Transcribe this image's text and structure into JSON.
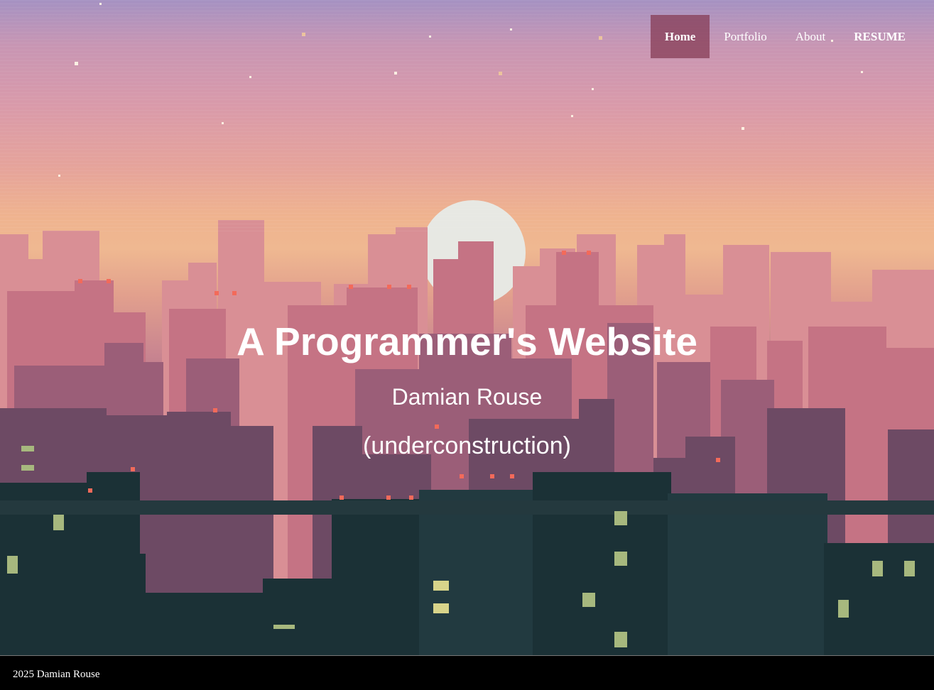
{
  "nav": {
    "items": [
      {
        "label": "Home"
      },
      {
        "label": "Portfolio"
      },
      {
        "label": "About"
      },
      {
        "label": "RESUME"
      }
    ]
  },
  "hero": {
    "title": "A Programmer's Website",
    "subtitle": "Damian Rouse",
    "note": "(underconstruction)"
  },
  "footer": {
    "text": "2025 Damian Rouse"
  },
  "colors": {
    "nav_active_bg": "#853c55",
    "sky_top": "#a592c2",
    "sky_mid": "#efb38f",
    "building_dark": "#15282d"
  }
}
